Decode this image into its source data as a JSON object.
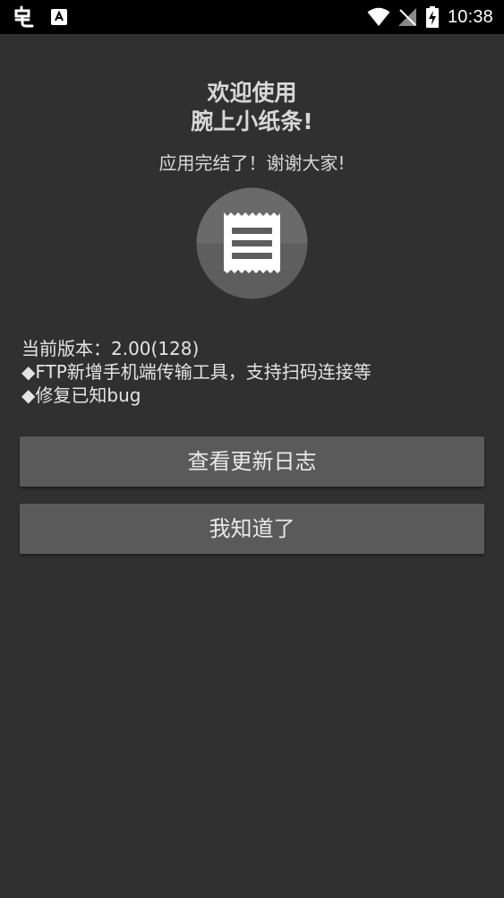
{
  "status_bar": {
    "time": "10:38",
    "left_icons": [
      "app-notification-icon",
      "keyboard-a-icon"
    ],
    "right_icons": [
      "wifi-icon",
      "no-signal-icon",
      "battery-charging-icon"
    ]
  },
  "dialog": {
    "title_line1": "欢迎使用",
    "title_line2": "腕上小纸条!",
    "subtitle": "应用完结了！谢谢大家!",
    "logo_icon": "receipt-icon",
    "version_line": "当前版本：2.00(128)",
    "changelog": [
      "◆FTP新增手机端传输工具，支持扫码连接等",
      "◆修复已知bug"
    ]
  },
  "buttons": {
    "view_log": "查看更新日志",
    "got_it": "我知道了"
  },
  "colors": {
    "background": "#303030",
    "status_bar": "#000000",
    "button": "#5a5a5a",
    "logo_circle": "#5e5e5e"
  }
}
